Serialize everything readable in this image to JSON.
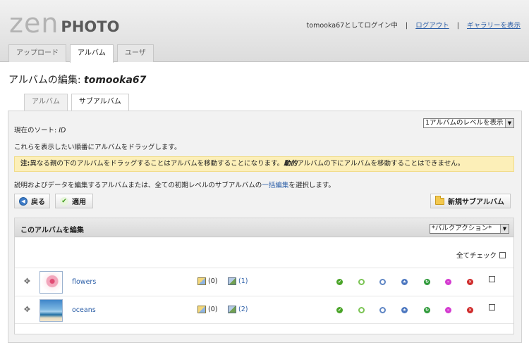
{
  "header": {
    "logo_part1": "zen",
    "logo_part2": "PHOTO",
    "login_text": "tomooka67としてログイン中",
    "logout_link": "ログアウト",
    "view_gallery_link": "ギャラリーを表示"
  },
  "main_tabs": [
    {
      "label": "アップロード",
      "active": false
    },
    {
      "label": "アルバム",
      "active": true
    },
    {
      "label": "ユーザ",
      "active": false
    }
  ],
  "page_title": {
    "prefix": "アルバムの編集: ",
    "album": "tomooka67"
  },
  "sub_tabs": [
    {
      "label": "アルバム",
      "active": false
    },
    {
      "label": "サブアルバム",
      "active": true
    }
  ],
  "sort": {
    "label": "現在のソート: ",
    "value": "ID"
  },
  "level_select": {
    "selected": "1アルバムのレベルを表示"
  },
  "drag_instruction": "これらを表示したい順番にアルバムをドラッグします。",
  "notice": {
    "bold_prefix": "注:",
    "text1": "異なる親の下のアルバムをドラッグすることはアルバムを移動することになります。",
    "dynamic": "動的",
    "text2": "アルバムの下にアルバムを移動することはできません。"
  },
  "description": {
    "text": "説明およびデータを編集するアルバムまたは、全ての初期レベルのサブアルバムの",
    "link": "一括編集",
    "suffix": "を選択します。"
  },
  "buttons": {
    "back": "戻る",
    "apply": "適用",
    "new_subalbum": "新規サブアルバム"
  },
  "panel": {
    "title": "このアルバムを編集",
    "bulk_action": "*バルクアクション*",
    "check_all": "全てチェック"
  },
  "albums": [
    {
      "name": "flowers",
      "images": "(0)",
      "subalbums": "(1)"
    },
    {
      "name": "oceans",
      "images": "(0)",
      "subalbums": "(2)"
    }
  ],
  "colors": {
    "link": "#2b5ea7",
    "notice_bg": "#fcefb8",
    "header_bg": "#dcdcdc"
  }
}
